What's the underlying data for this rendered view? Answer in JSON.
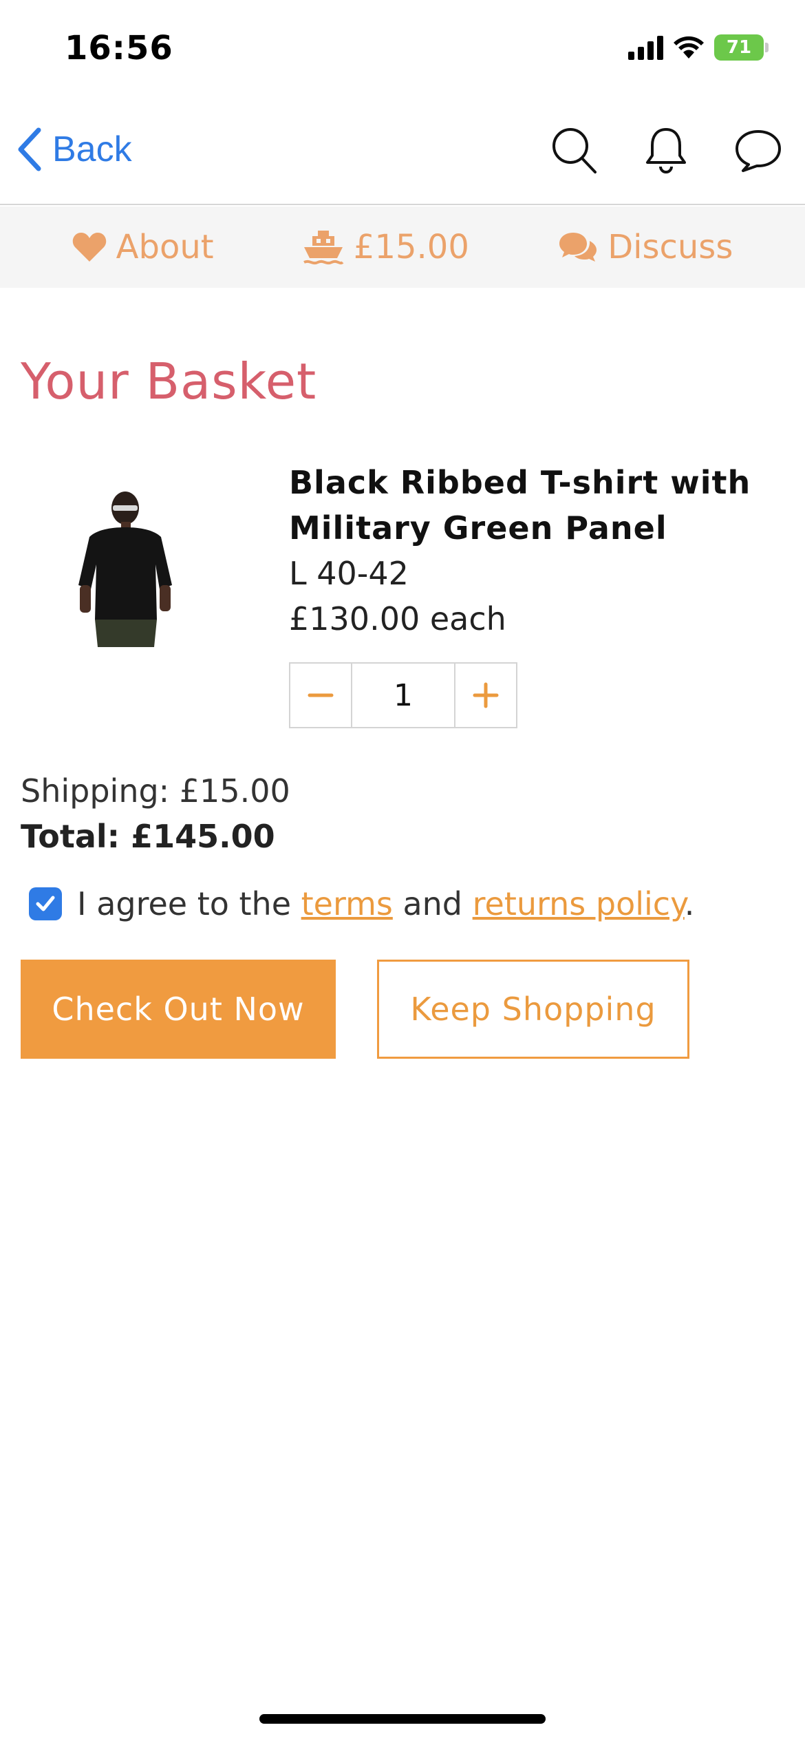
{
  "status_bar": {
    "time": "16:56",
    "battery": "71"
  },
  "nav": {
    "back_label": "Back",
    "icons": [
      "search-icon",
      "bell-icon",
      "chat-bubble-icon"
    ]
  },
  "tabs": [
    {
      "label": "About",
      "icon": "heart-icon"
    },
    {
      "label": "£15.00",
      "icon": "ship-icon"
    },
    {
      "label": "Discuss",
      "icon": "comments-icon"
    }
  ],
  "basket": {
    "title": "Your Basket",
    "item": {
      "name": "Black Ribbed T-shirt with Military Green Panel",
      "size": "L 40-42",
      "price": "£130.00 each",
      "quantity": "1"
    },
    "shipping": "Shipping: £15.00",
    "total": "Total: £145.00",
    "agree": {
      "checked": true,
      "prefix": "I agree to the",
      "terms_link": "terms",
      "middle": "and",
      "returns_link": "returns policy",
      "suffix": "."
    },
    "checkout_label": "Check Out Now",
    "keep_shopping_label": "Keep Shopping"
  },
  "colors": {
    "accent": "#f09b40",
    "tab_text": "#eba26a",
    "title": "#d65f6c",
    "link_blue": "#2f7be5"
  }
}
